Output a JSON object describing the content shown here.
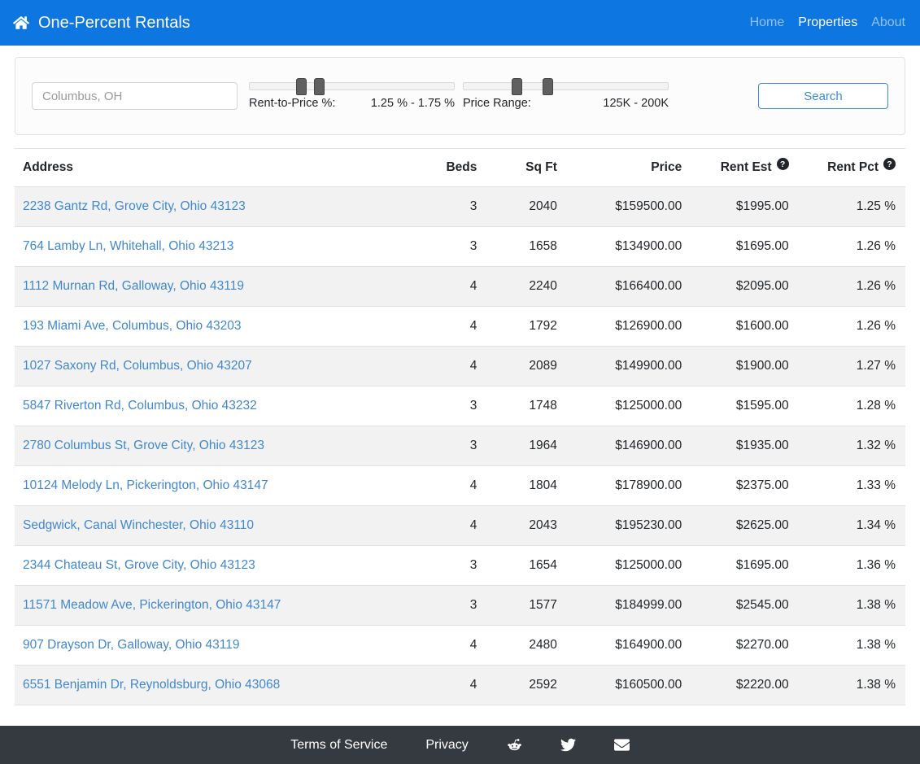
{
  "navbar": {
    "brand": {
      "label": "One-Percent Rentals",
      "icon": "home-icon"
    },
    "links": [
      {
        "label": "Home",
        "active": false
      },
      {
        "label": "Properties",
        "active": true
      },
      {
        "label": "About",
        "active": false
      }
    ]
  },
  "search": {
    "location": {
      "placeholder": "Columbus, OH"
    },
    "rent_to_price": {
      "label": "Rent-to-Price %:",
      "value": "1.25 % - 1.75 %"
    },
    "price_range": {
      "label": "Price Range:",
      "value": "125K - 200K"
    },
    "button_label": "Search"
  },
  "table": {
    "headers": {
      "address": "Address",
      "beds": "Beds",
      "sqft": "Sq Ft",
      "price": "Price",
      "rent_est": "Rent Est",
      "rent_pct": "Rent Pct"
    },
    "info_icon": "question-circle-icon",
    "rows": [
      {
        "address": "2238 Gantz Rd, Grove City, Ohio 43123",
        "beds": "3",
        "sqft": "2040",
        "price": "$159500.00",
        "rent_est": "$1995.00",
        "rent_pct": "1.25 %"
      },
      {
        "address": "764 Lamby Ln, Whitehall, Ohio 43213",
        "beds": "3",
        "sqft": "1658",
        "price": "$134900.00",
        "rent_est": "$1695.00",
        "rent_pct": "1.26 %"
      },
      {
        "address": "1112 Murnan Rd, Galloway, Ohio 43119",
        "beds": "4",
        "sqft": "2240",
        "price": "$166400.00",
        "rent_est": "$2095.00",
        "rent_pct": "1.26 %"
      },
      {
        "address": "193 Miami Ave, Columbus, Ohio 43203",
        "beds": "4",
        "sqft": "1792",
        "price": "$126900.00",
        "rent_est": "$1600.00",
        "rent_pct": "1.26 %"
      },
      {
        "address": "1027 Saxony Rd, Columbus, Ohio 43207",
        "beds": "4",
        "sqft": "2089",
        "price": "$149900.00",
        "rent_est": "$1900.00",
        "rent_pct": "1.27 %"
      },
      {
        "address": "5847 Riverton Rd, Columbus, Ohio 43232",
        "beds": "3",
        "sqft": "1748",
        "price": "$125000.00",
        "rent_est": "$1595.00",
        "rent_pct": "1.28 %"
      },
      {
        "address": "2780 Columbus St, Grove City, Ohio 43123",
        "beds": "3",
        "sqft": "1964",
        "price": "$146900.00",
        "rent_est": "$1935.00",
        "rent_pct": "1.32 %"
      },
      {
        "address": "10124 Melody Ln, Pickerington, Ohio 43147",
        "beds": "4",
        "sqft": "1804",
        "price": "$178900.00",
        "rent_est": "$2375.00",
        "rent_pct": "1.33 %"
      },
      {
        "address": "Sedgwick, Canal Winchester, Ohio 43110",
        "beds": "4",
        "sqft": "2043",
        "price": "$195230.00",
        "rent_est": "$2625.00",
        "rent_pct": "1.34 %"
      },
      {
        "address": "2344 Chateau St, Grove City, Ohio 43123",
        "beds": "3",
        "sqft": "1654",
        "price": "$125000.00",
        "rent_est": "$1695.00",
        "rent_pct": "1.36 %"
      },
      {
        "address": "11571 Meadow Ave, Pickerington, Ohio 43147",
        "beds": "3",
        "sqft": "1577",
        "price": "$184999.00",
        "rent_est": "$2545.00",
        "rent_pct": "1.38 %"
      },
      {
        "address": "907 Drayson Dr, Galloway, Ohio 43119",
        "beds": "4",
        "sqft": "2480",
        "price": "$164900.00",
        "rent_est": "$2270.00",
        "rent_pct": "1.38 %"
      },
      {
        "address": "6551 Benjamin Dr, Reynoldsburg, Ohio 43068",
        "beds": "4",
        "sqft": "2592",
        "price": "$160500.00",
        "rent_est": "$2220.00",
        "rent_pct": "1.38 %"
      }
    ]
  },
  "footer": {
    "links": [
      {
        "label": "Terms of Service"
      },
      {
        "label": "Privacy"
      }
    ],
    "icons": [
      "reddit-icon",
      "twitter-icon",
      "envelope-icon"
    ]
  },
  "colors": {
    "navbar_bg": "#0d76e0",
    "link_blue": "#4187d0",
    "footer_bg": "#343a40",
    "row_stripe": "#f2f2f2",
    "button_outline": "#3d8bd8"
  }
}
